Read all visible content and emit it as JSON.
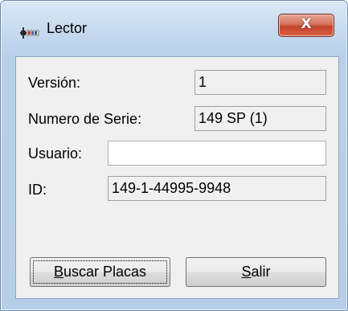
{
  "window": {
    "title": "Lector",
    "close_glyph": "X",
    "icon": "app-icon"
  },
  "form": {
    "version_label": "Versión:",
    "version_value": "1",
    "serial_label": "Numero de Serie:",
    "serial_value": "149 SP (1)",
    "user_label": "Usuario:",
    "user_value": "",
    "id_label": "ID:",
    "id_value": "149-1-44995-9948"
  },
  "buttons": {
    "search_access": "B",
    "search_rest": "uscar Placas",
    "exit_access": "S",
    "exit_rest": "alir"
  },
  "colors": {
    "close_button": "#c2452c",
    "frame": "#b9d0ea",
    "client": "#f0f0f0"
  }
}
